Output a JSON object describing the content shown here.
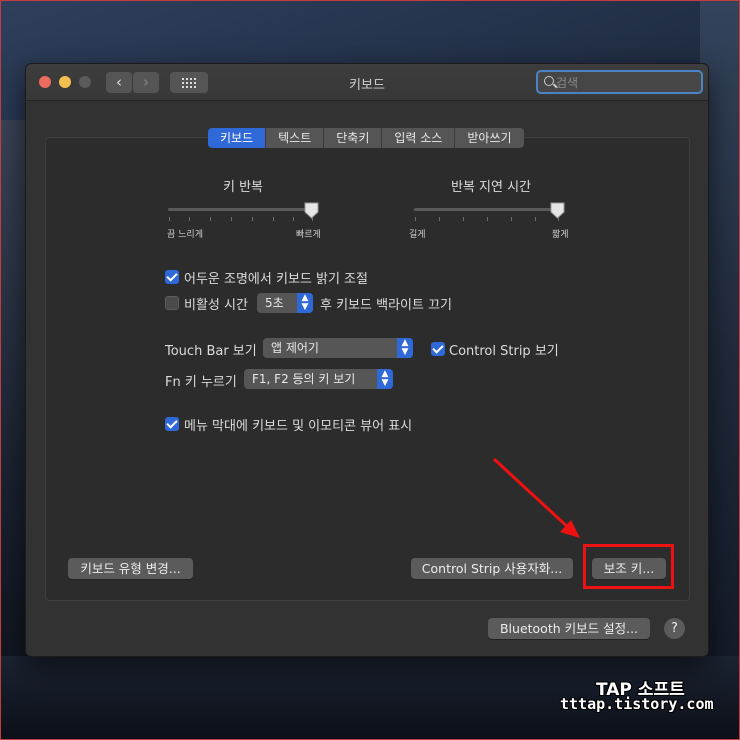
{
  "window": {
    "title": "키보드"
  },
  "search": {
    "placeholder": "검색"
  },
  "tabs": [
    {
      "label": "키보드",
      "active": true
    },
    {
      "label": "텍스트",
      "active": false
    },
    {
      "label": "단축키",
      "active": false
    },
    {
      "label": "입력 소스",
      "active": false
    },
    {
      "label": "받아쓰기",
      "active": false
    }
  ],
  "key_repeat": {
    "title": "키 반복",
    "left_labels": "끔  느리게",
    "right_label": "빠르게",
    "value": 1.0
  },
  "repeat_delay": {
    "title": "반복 지연 시간",
    "left_label": "길게",
    "right_label": "짧게",
    "value": 1.0
  },
  "options": {
    "adjust_brightness": {
      "label": "어두운 조명에서 키보드 밝기 조절",
      "checked": true
    },
    "idle_prefix": "비활성 시간",
    "idle_value": "5초",
    "idle_suffix": "후 키보드 백라이트 끄기",
    "idle_checked": false,
    "touch_bar_label": "Touch Bar 보기",
    "touch_bar_value": "앱 제어기",
    "control_strip": {
      "label": "Control Strip 보기",
      "checked": true
    },
    "fn_label": "Fn 키 누르기",
    "fn_value": "F1, F2 등의 키 보기",
    "menu_bar": {
      "label": "메뉴 막대에 키보드 및 이모티콘 뷰어 표시",
      "checked": true
    }
  },
  "buttons": {
    "change_type": "키보드 유형 변경...",
    "control_strip_customize": "Control Strip 사용자화...",
    "modifier_keys": "보조 키...",
    "bluetooth": "Bluetooth 키보드 설정...",
    "help": "?"
  },
  "watermark": {
    "line1": "TAP 소프트",
    "line2": "tttap.tistory.com"
  },
  "colors": {
    "accent": "#2f69d8",
    "highlight": "#e11111"
  }
}
